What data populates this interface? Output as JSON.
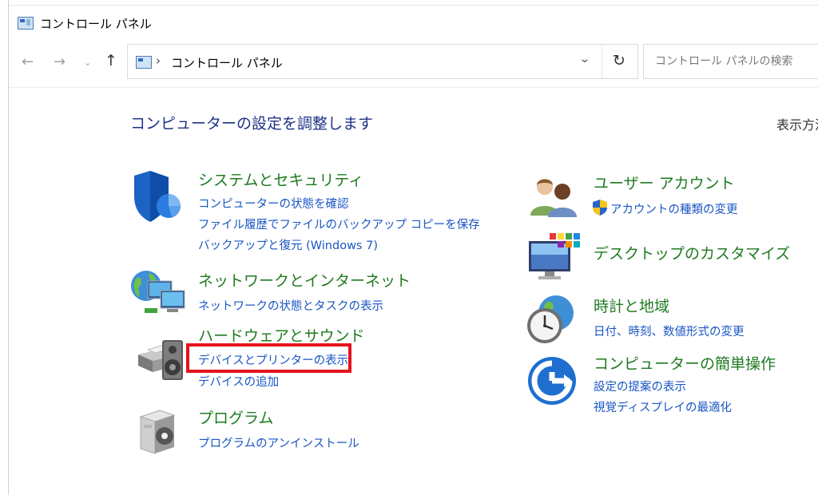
{
  "window": {
    "title": "コントロール パネル"
  },
  "navigation": {
    "back_icon": "←",
    "forward_icon": "→",
    "recent_icon": "⌄",
    "up_icon": "↑",
    "breadcrumb_sep": "›",
    "breadcrumb": "コントロール パネル",
    "dropdown_icon": "⌄",
    "refresh_icon": "↻",
    "search_placeholder": "コントロール パネルの検索"
  },
  "main": {
    "heading": "コンピューターの設定を調整します",
    "view_by": "表示方法"
  },
  "categories": {
    "system_security": {
      "title": "システムとセキュリティ",
      "links": [
        "コンピューターの状態を確認",
        "ファイル履歴でファイルのバックアップ コピーを保存",
        "バックアップと復元 (Windows 7)"
      ]
    },
    "network": {
      "title": "ネットワークとインターネット",
      "links": [
        "ネットワークの状態とタスクの表示"
      ]
    },
    "hardware": {
      "title": "ハードウェアとサウンド",
      "links": [
        "デバイスとプリンターの表示",
        "デバイスの追加"
      ]
    },
    "programs": {
      "title": "プログラム",
      "links": [
        "プログラムのアンインストール"
      ]
    },
    "user_accounts": {
      "title": "ユーザー アカウント",
      "links": [
        "アカウントの種類の変更"
      ]
    },
    "appearance": {
      "title": "デスクトップのカスタマイズ"
    },
    "clock_region": {
      "title": "時計と地域",
      "links": [
        "日付、時刻、数値形式の変更"
      ]
    },
    "ease_of_access": {
      "title": "コンピューターの簡単操作",
      "links": [
        "設定の提案の表示",
        "視覚ディスプレイの最適化"
      ]
    }
  },
  "colors": {
    "category_title": "#1f7a1f",
    "link": "#1a56c4",
    "heading": "#1e3287",
    "highlight": "#e4141b"
  }
}
